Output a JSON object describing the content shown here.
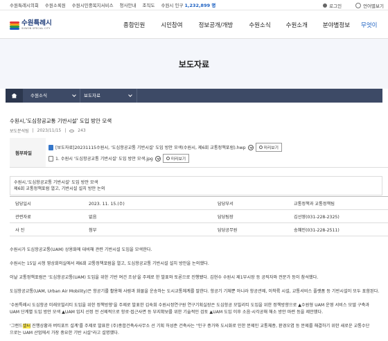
{
  "util": {
    "links": [
      "수원특례시의회",
      "수원소록원",
      "수원시민중복지서비스",
      "청사안내",
      "조직도"
    ],
    "population_label": "수원시 인구",
    "population_value": "1,232,899 명",
    "login": "로그인",
    "language": "언어별보기"
  },
  "header": {
    "logo_ko": "수원특례시",
    "logo_en": "SUWON SPECIAL CITY",
    "logo_colors": [
      "#e23a3a",
      "#f2a21c",
      "#2a9a46",
      "#1c5fc0"
    ],
    "nav": [
      "종합민원",
      "시민참여",
      "정보공개/개방",
      "수원소식",
      "수원소개",
      "분야별정보",
      "무엇이"
    ]
  },
  "page_title": "보도자료",
  "breadcrumb": {
    "level1": "수원소식",
    "level2": "보도자료"
  },
  "article": {
    "title": "수원시,'도심항공교통 기반시설' 도입 방안 모색",
    "department": "보도분석팀",
    "date": "2023/11/15",
    "views": "243",
    "attach_label": "첨부파일",
    "files": [
      "[보도자료]20231115수원시, '도심항공교통 기반시설' 도입 방안 모색(수원시, 제6회 교통정책포럼).hwp",
      "1. 수원시 '도심항공교통 기반시설' 도입 방안 모색.jpg"
    ],
    "preview_label": "미리보기",
    "summary": [
      "수원시,'도심항공교통 기반시설' 도입 방안 모색",
      "제6회 교통정책포럼 열고, 기반시설 설치 방안 논의"
    ],
    "table": [
      [
        "담당일시",
        "2023. 11. 15.(수)",
        "담당부서",
        "교통정책과 교통정책팀"
      ],
      [
        "관련자료",
        "없음",
        "담당팀장",
        "김선영(031-228-2325)"
      ],
      [
        "사 진",
        "첨부",
        "담당공무원",
        "송혜민(031-228-2511)"
      ]
    ],
    "paragraphs": [
      "수원시가 도심항공교통(UAM) 상용화에 대비해 관련 기반시설 도입을 모색한다.",
      "수원시는 15일 시청 영상회의실에서 제6회 교통정책포럼을 열고, 도심항공교통 기반시설 설치 방안을 논의했다.",
      "이날 교통정책포럼은 '도심항공교통(UAM) 도입을 위한 기반 여건 조성'을 주제로 한 발표와 토론으로 진행됐다. 김현수 수원시 제1부시장 등 공직자와 전문가 등이 참석했다.",
      "도심항공교통(UAM, Urban Air Mobility)은 항공기를 활용해 사람과 화물을 운송하는 도시교통체계를 말한다. 항공기 기체뿐 아니라 항공관제, 이착륙 시설, 교통서비스 플랫폼 등 기반시설이 모두 포함된다.",
      "'수원특례시 도심항공 미래모빌리티 도입을 위한 정책방향'을 주제로 발표한 김숙희 수원시정연구원 연구기획실장은 도심항공 모빌리티 도입을 위한 정책방향으로 ▲수원형 UAM 운영 서비스 모델 구축과",
      "UAM 단계별 도입 방안 모색 ▲UAM 입지 선정 전 선제적으로 항로·접근사면 등 부지확보를 위한 기술적인 검토 ▲UAM 도입 이후 소음·시각공해 해소 방안 마련 등을 제안했다.",
      "'그랜드",
      "셀터",
      " 진행상황과 버티포트 설계'를 주제로 발표한 (주)종합건축사사무소 선 기획 허성준 건축사는 \"인구 증가와 도시화로 인한 문제인 교통체증, 환경오염 등 문제를 해결하기 위한 새로운 교통수단",
      "으로는 UAM 산업에서 가장 중요한 기반 시설\"라고 설명했다."
    ]
  }
}
